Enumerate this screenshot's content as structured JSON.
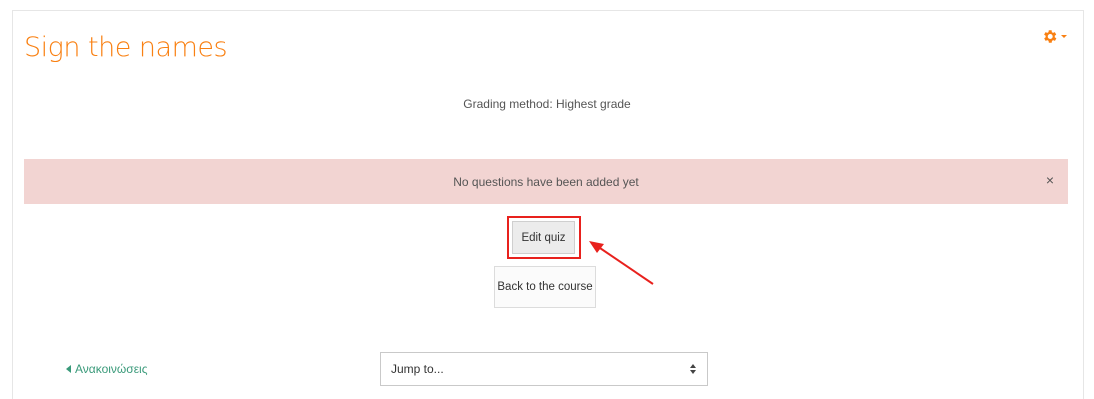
{
  "page": {
    "title": "Sign the names",
    "grading_method": "Grading method: Highest grade"
  },
  "alert": {
    "message": "No questions have been added yet",
    "close_label": "×"
  },
  "buttons": {
    "edit_quiz": "Edit quiz",
    "back_to_course": "Back to the course"
  },
  "navigation": {
    "previous_activity": "Ανακοινώσεις",
    "jump_to_placeholder": "Jump to..."
  },
  "icons": {
    "settings": "gear-icon",
    "dropdown_caret": "chevron-down-icon",
    "previous": "triangle-left-icon",
    "select_arrows": "updown-icon"
  },
  "colors": {
    "brand_orange": "#f98012",
    "alert_background": "#f2d4d2",
    "annotation_red": "#e8211d",
    "link_green": "#3a9a7a"
  }
}
